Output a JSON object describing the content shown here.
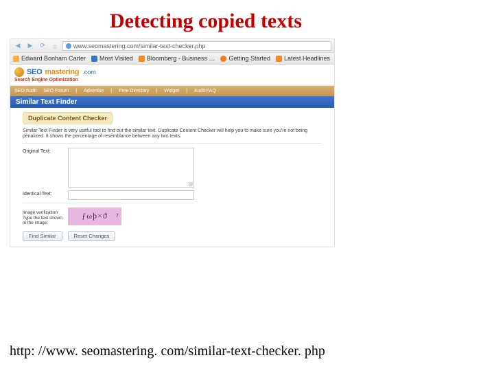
{
  "slide": {
    "title": "Detecting copied texts",
    "footer_url": "http: //www. seomastering. com/similar-text-checker. php"
  },
  "browser": {
    "url": "www.seomastering.com/similar-text-checker.php",
    "bookmarks": {
      "b0": "Edward Bonham Carter",
      "b1": "Most Visited",
      "b2": "Bloomberg - Business …",
      "b3": "Getting Started",
      "b4": "Latest Headlines"
    }
  },
  "site": {
    "logo_seo": "SEO",
    "logo_mast": "mastering",
    "logo_com": ".com",
    "tagline": "Search Engine Optimization",
    "nav": {
      "n0": "SEO Audit",
      "n1": "SEO Forum",
      "n2": "Advertise",
      "n3": "Free Directory",
      "n4": "Widget",
      "n5": "Audit FAQ"
    },
    "toolbar_title": "Similar Text Finder"
  },
  "content": {
    "panel_title": "Duplicate Content Checker",
    "blurb": "Similar Text Finder is very useful tool to find out the similar text. Duplicate Content Checker will help you to make sure you're not being penalized. It shows the percentage of resemblance between any two texts.",
    "label_original": "Original Text:",
    "label_identical": "Identical Text:",
    "captcha_label": "Image verification\nType the text shown\nin the image:",
    "captcha_text": "ƒωþ×ϑ",
    "captcha_sup": "7",
    "btn_find": "Find Similar",
    "btn_reset": "Reset Changes"
  }
}
